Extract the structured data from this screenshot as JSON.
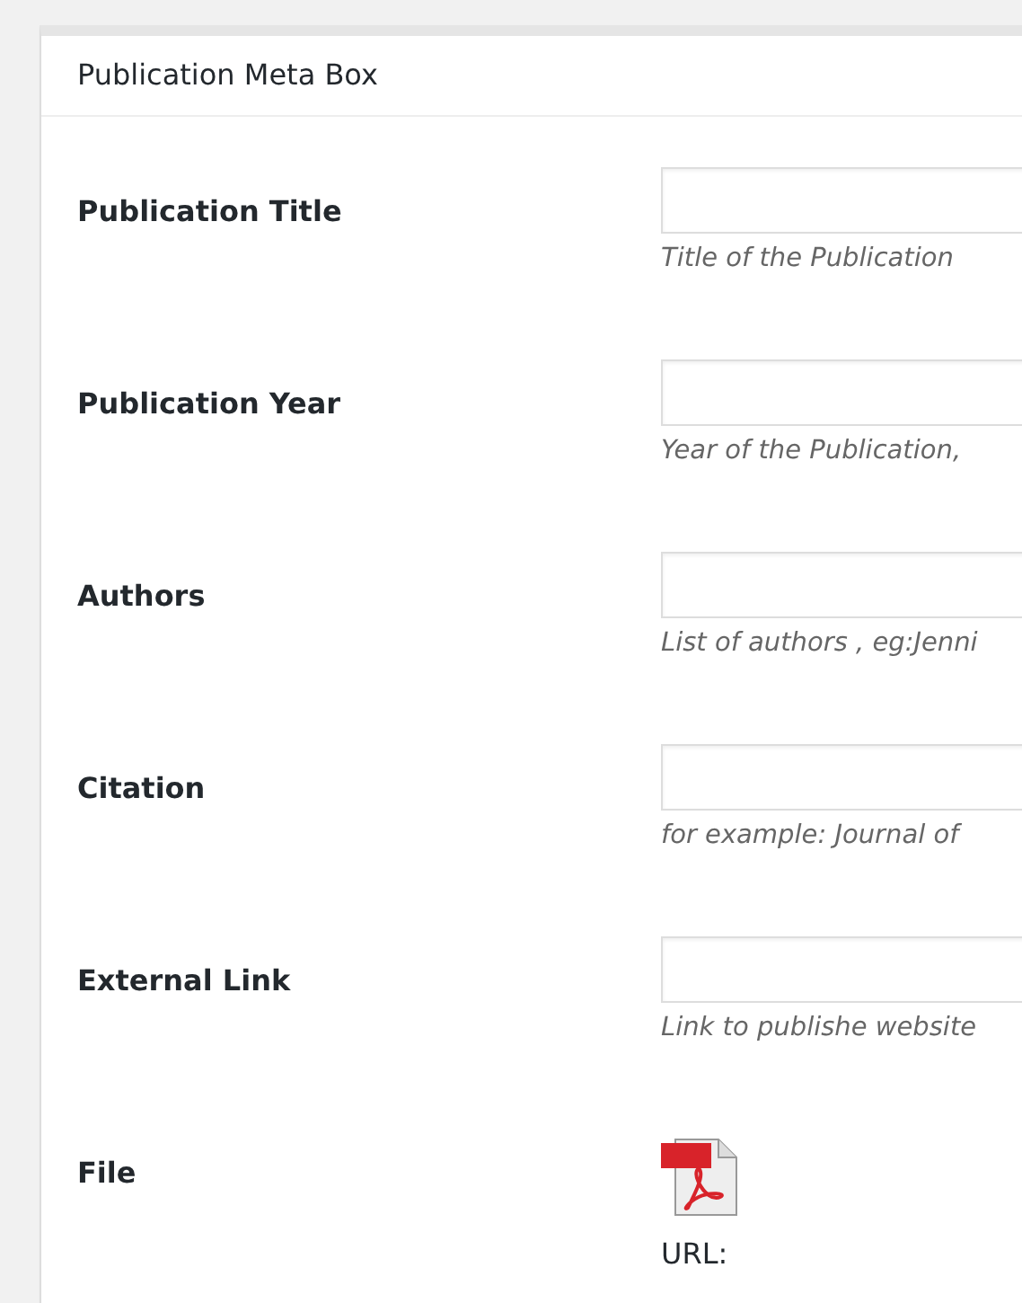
{
  "panel": {
    "title": "Publication Meta Box"
  },
  "fields": [
    {
      "kind": "text",
      "label": "Publication Title",
      "description": "Title of the Publication"
    },
    {
      "kind": "text",
      "label": "Publication Year",
      "description": "Year of the Publication,"
    },
    {
      "kind": "text",
      "label": "Authors",
      "description": "List of authors , eg:Jenni"
    },
    {
      "kind": "text",
      "label": "Citation",
      "description": "for example: Journal of"
    },
    {
      "kind": "text",
      "label": "External Link",
      "description": "Link to publishe website"
    },
    {
      "kind": "file",
      "label": "File",
      "url_label": "URL:"
    }
  ]
}
